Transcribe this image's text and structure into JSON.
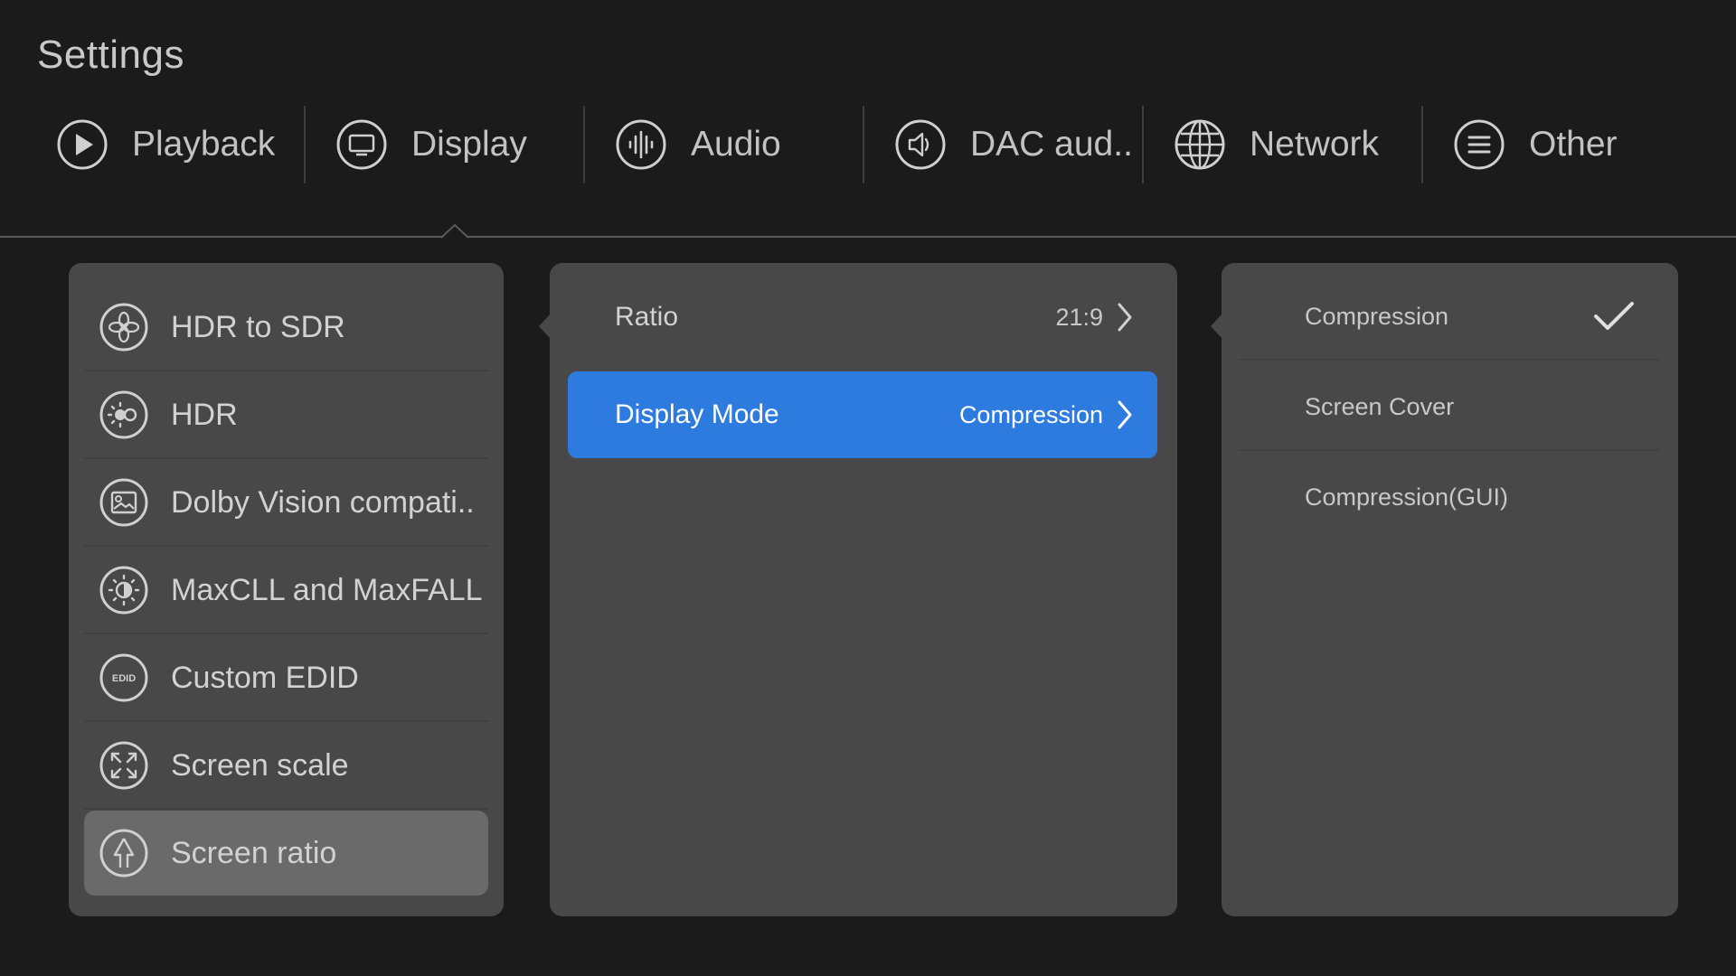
{
  "window": {
    "title": "Settings"
  },
  "colors": {
    "background": "#1b1b1b",
    "panel": "#484848",
    "selected_item": "#6a6a6a",
    "accent": "#2e7be0"
  },
  "tabs": [
    {
      "label": "Playback",
      "icon": "play-circle-icon"
    },
    {
      "label": "Display",
      "icon": "monitor-icon",
      "active": true
    },
    {
      "label": "Audio",
      "icon": "audio-wave-icon"
    },
    {
      "label": "DAC aud..",
      "icon": "speaker-icon"
    },
    {
      "label": "Network",
      "icon": "globe-icon"
    },
    {
      "label": "Other",
      "icon": "menu-lines-icon"
    }
  ],
  "display_menu": {
    "items": [
      {
        "label": "HDR to SDR",
        "icon": "aperture-icon"
      },
      {
        "label": "HDR",
        "icon": "hdr-sun-icon"
      },
      {
        "label": "Dolby Vision compati..",
        "icon": "image-frame-icon"
      },
      {
        "label": "MaxCLL and MaxFALL",
        "icon": "brightness-icon"
      },
      {
        "label": "Custom EDID",
        "icon": "edid-badge-icon",
        "badge_text": "EDID"
      },
      {
        "label": "Screen scale",
        "icon": "expand-arrows-icon"
      },
      {
        "label": "Screen ratio",
        "icon": "ratio-arrow-icon",
        "selected": true
      }
    ]
  },
  "screen_ratio": {
    "rows": [
      {
        "label": "Ratio",
        "value": "21:9"
      },
      {
        "label": "Display Mode",
        "value": "Compression",
        "active": true
      }
    ]
  },
  "display_mode_options": {
    "options": [
      {
        "label": "Compression",
        "checked": true
      },
      {
        "label": "Screen Cover"
      },
      {
        "label": "Compression(GUI)"
      }
    ]
  }
}
